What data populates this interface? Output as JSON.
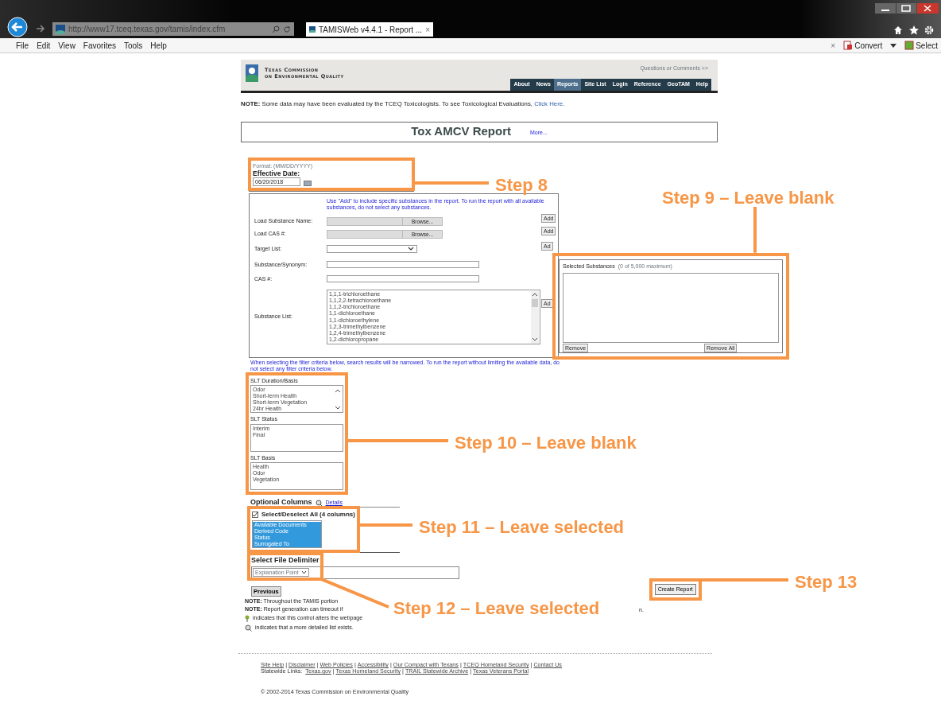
{
  "browser": {
    "url": "http://www17.tceq.texas.gov/tamis/index.cfm",
    "tab": {
      "title": "TAMISWeb v4.4.1 - Report ...",
      "close": "×"
    },
    "menu": [
      "File",
      "Edit",
      "View",
      "Favorites",
      "Tools",
      "Help"
    ],
    "toolbar": {
      "close": "×",
      "convert": "Convert",
      "select": "Select"
    }
  },
  "header": {
    "org_line_1": "Texas Commission",
    "org_line_2": "on Environmental Quality",
    "questions": "Questions or Comments >>",
    "nav": [
      {
        "label": "About",
        "selected": false
      },
      {
        "label": "News",
        "selected": false
      },
      {
        "label": "Reports",
        "selected": true
      },
      {
        "label": "Site List",
        "selected": false
      },
      {
        "label": "Login",
        "selected": false
      },
      {
        "label": "Reference",
        "selected": false
      },
      {
        "label": "GeoTAM",
        "selected": false
      },
      {
        "label": "Help",
        "selected": false
      }
    ]
  },
  "note": {
    "text": "**NOTE:** Some data may have been evaluated by the TCEQ Toxicologists. To see Toxicological Evaluations, ",
    "link": "Click Here",
    "after": "."
  },
  "report": {
    "title": "Tox AMCV Report",
    "more": "More..."
  },
  "date": {
    "format": "Format: (MM/DD/YYYY)",
    "label": "Effective Date:",
    "value": "06/20/2018"
  },
  "substances": {
    "hint": "Use \"Add\" to include specific substances in the report. To run the report with all available substances, do not select any substances.",
    "rows": [
      {
        "kind": "file",
        "label": "Load Substance Name:",
        "button": "Browse...",
        "add": "Add"
      },
      {
        "kind": "file",
        "label": "Load CAS #:",
        "button": "Browse...",
        "add": "Add"
      },
      {
        "kind": "select",
        "label": "Target List:",
        "add": "Ad"
      },
      {
        "kind": "text",
        "label": "Substance/Synonym:"
      },
      {
        "kind": "text",
        "label": "CAS #:"
      },
      {
        "kind": "list",
        "label": "Substance List:",
        "add": "Ad",
        "options": [
          "1,1,1-trichloroethane",
          "1,1,2,2-tetrachloroethane",
          "1,1,2-trichloroethane",
          "1,1-dichloroethane",
          "1,1-dichloroethylene",
          "1,2,3-trimethylbenzene",
          "1,2,4-trimethylbenzene",
          "1,2-dichloropropane"
        ]
      }
    ]
  },
  "selected_substances": {
    "title": "Selected Substances",
    "count": "(0 of 5,000 maximum)",
    "remove": "Remove",
    "remove_all": "Remove All"
  },
  "filter_hint": "When selecting the filter criteria below, search results will be narrowed. To run the report without limiting the available data, do not select any filter criteria below.",
  "slt": [
    {
      "label": "SLT Duration/Basis",
      "kind": "scrolling",
      "options": [
        "Odor",
        "Short-term Health",
        "Short-term Vegetation",
        "24hr Health"
      ]
    },
    {
      "label": "SLT Status",
      "kind": "plain",
      "options": [
        "Interim",
        "Final"
      ]
    },
    {
      "label": "SLT Basis",
      "kind": "plain",
      "options": [
        "Health",
        "Odor",
        "Vegetation"
      ]
    }
  ],
  "optional_columns": {
    "title": "Optional Columns",
    "details": "Details",
    "select_all": {
      "label": "Select/Deselect All (4 columns)",
      "checked": true
    },
    "columns": [
      {
        "label": "Available Documents",
        "selected": true
      },
      {
        "label": "Derived Code",
        "selected": true
      },
      {
        "label": "Status",
        "selected": true
      },
      {
        "label": "Surrogated To",
        "selected": true
      }
    ]
  },
  "delimiter": {
    "title": "Select File Delimiter",
    "value": "Explanation Point"
  },
  "buttons": {
    "previous": "Previous",
    "create": "Create Report"
  },
  "notes": [
    {
      "kind": "note",
      "text": "**NOTE:** Throughout the TAMIS portion"
    },
    {
      "kind": "note",
      "text": "**NOTE:** Report generation can timeout if",
      "tail": "n."
    },
    {
      "kind": "pin",
      "text": "indicates that this control alters the webpage"
    },
    {
      "kind": "magnifier",
      "text": "indicates that a more detailed list exists."
    }
  ],
  "footer": {
    "separator": "|",
    "links": [
      "Site Help",
      "Disclaimer",
      "Web Policies",
      "Accessibility",
      "Our Compact with Texans",
      "TCEQ Homeland Security",
      "Contact Us"
    ],
    "statewide_label": "Statewide Links:",
    "statewide": [
      "Texas.gov",
      "Texas Homeland Security",
      "TRAIL Statewide Archive",
      "Texas Veterans Portal"
    ],
    "copyright": "© 2002-2014 Texas Commission on Environmental Quality"
  },
  "callouts": [
    {
      "label": "Step 8"
    },
    {
      "label": "Step 9 – Leave blank"
    },
    {
      "label": "Step 10 – Leave blank"
    },
    {
      "label": "Step 11 – Leave selected"
    },
    {
      "label": "Step 12 – Leave selected"
    },
    {
      "label": "Step 13"
    }
  ]
}
